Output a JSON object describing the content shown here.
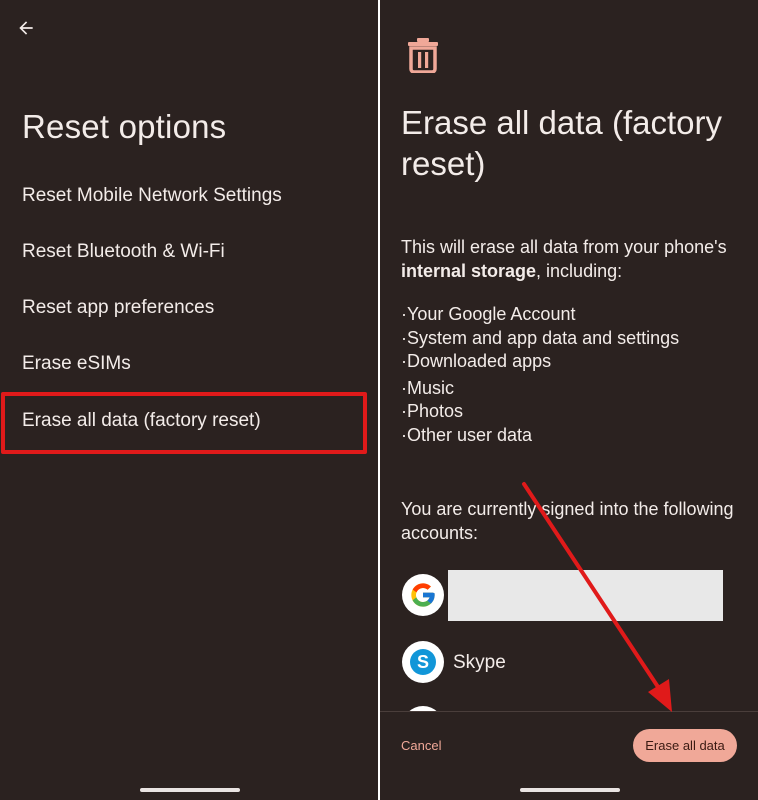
{
  "left": {
    "title": "Reset options",
    "options": [
      "Reset Mobile Network Settings",
      "Reset Bluetooth & Wi-Fi",
      "Reset app preferences",
      "Erase eSIMs",
      "Erase all data (factory reset)"
    ]
  },
  "right": {
    "title": "Erase all data (factory reset)",
    "desc_pre": "This will erase all data from your phone's ",
    "desc_bold": "internal storage",
    "desc_post": ", including:",
    "bullets": [
      "Your Google Account",
      "System and app data and settings",
      "Downloaded apps",
      "Music",
      "Photos",
      "Other user data"
    ],
    "signed_in_text": "You are currently signed into the following accounts:",
    "accounts": [
      {
        "icon": "google-icon",
        "label": ""
      },
      {
        "icon": "skype-icon",
        "label": "Skype"
      }
    ],
    "cancel_label": "Cancel",
    "erase_label": "Erase all data"
  },
  "colors": {
    "background": "#2b2220",
    "text": "#f3ece9",
    "accent": "#f0a898",
    "annotation": "#e01a1a"
  }
}
